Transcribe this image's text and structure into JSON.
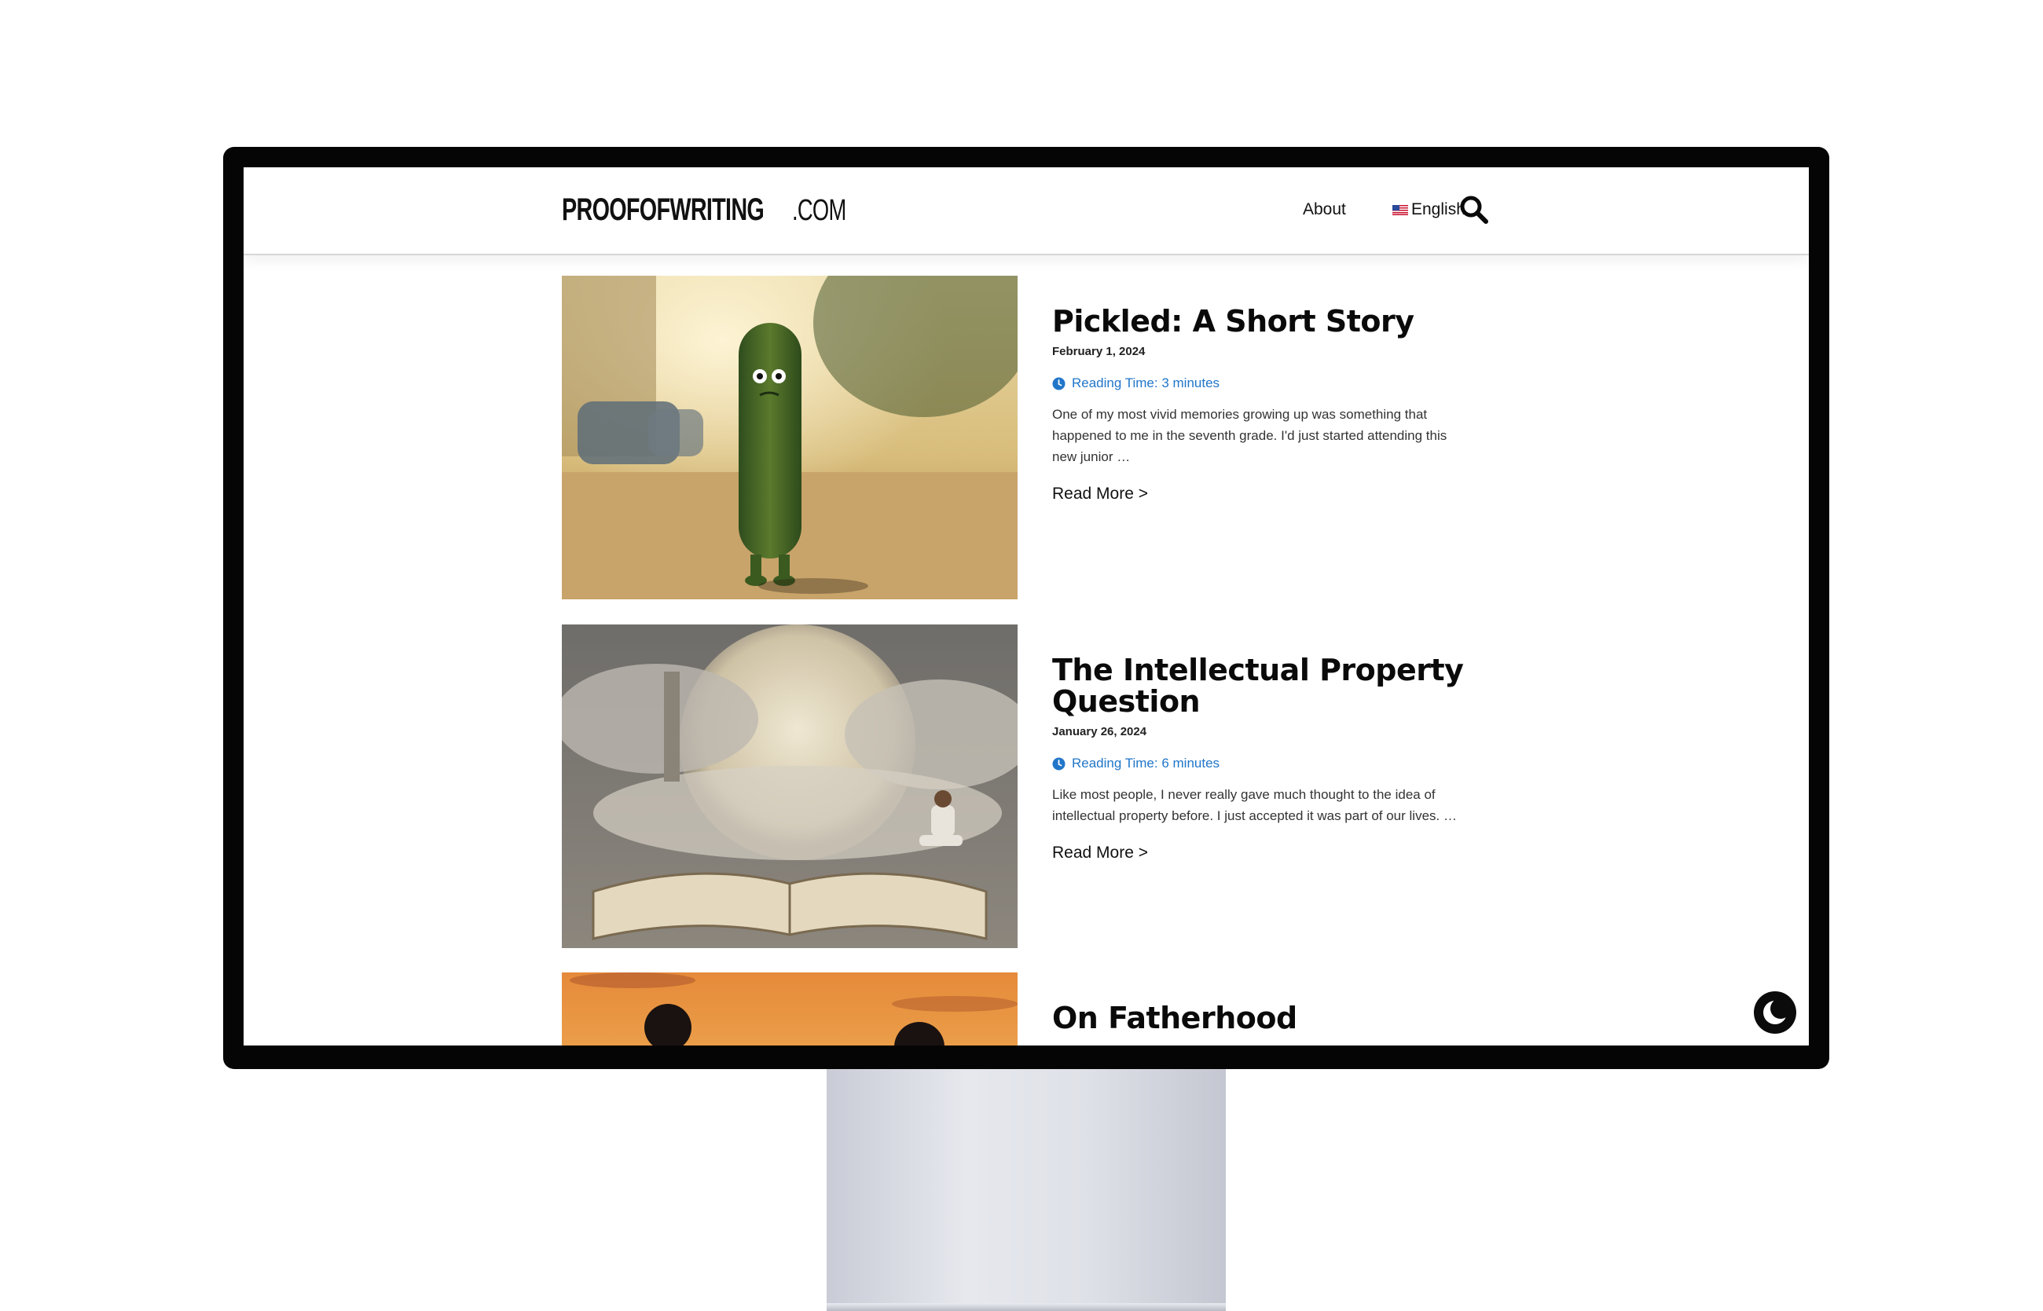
{
  "site": {
    "logo_bold": "PROOFOFWRITING",
    "logo_light": ".COM"
  },
  "nav": {
    "about": "About",
    "language": "English",
    "search_icon": "search-icon",
    "flag_icon": "us-flag-icon"
  },
  "posts": [
    {
      "title": "Pickled: A Short Story",
      "date": "February 1, 2024",
      "reading_time": "Reading Time: 3 minutes",
      "excerpt": "One of my most vivid memories growing up was something that happened to me in the seventh grade. I'd just started attending this new junior …",
      "read_more": "Read More >"
    },
    {
      "title": "The Intellectual Property Question",
      "date": "January 26, 2024",
      "reading_time": "Reading Time: 6 minutes",
      "excerpt": "Like most people, I never really gave much thought to the idea of intellectual property before. I just accepted it was part of our lives. …",
      "read_more": "Read More >"
    },
    {
      "title": "On Fatherhood"
    }
  ],
  "theme": {
    "accent": "#2176c9",
    "toggle_icon": "moon-icon"
  }
}
